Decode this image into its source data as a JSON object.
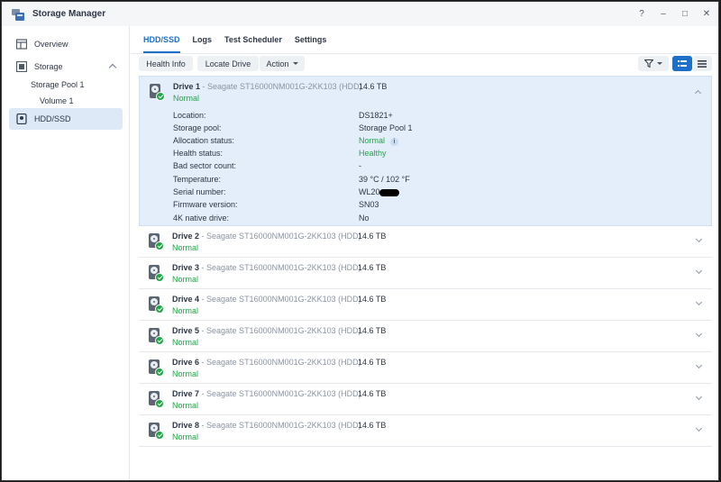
{
  "window": {
    "title": "Storage Manager",
    "controls": [
      "?",
      "–",
      "□",
      "✕"
    ]
  },
  "sidebar": {
    "overview": "Overview",
    "storage": "Storage",
    "storage_pool": "Storage Pool 1",
    "volume": "Volume 1",
    "hdd_ssd": "HDD/SSD"
  },
  "tabs": [
    "HDD/SSD",
    "Logs",
    "Test Scheduler",
    "Settings"
  ],
  "toolbar": {
    "health_info": "Health Info",
    "locate_drive": "Locate Drive",
    "action": "Action"
  },
  "drives": [
    {
      "name": "Drive 1",
      "model": " - Seagate ST16000NM001G-2KK103 (HDD)",
      "size": "14.6 TB",
      "status": "Normal"
    },
    {
      "name": "Drive 2",
      "model": " - Seagate ST16000NM001G-2KK103 (HDD)",
      "size": "14.6 TB",
      "status": "Normal"
    },
    {
      "name": "Drive 3",
      "model": " - Seagate ST16000NM001G-2KK103 (HDD)",
      "size": "14.6 TB",
      "status": "Normal"
    },
    {
      "name": "Drive 4",
      "model": " - Seagate ST16000NM001G-2KK103 (HDD)",
      "size": "14.6 TB",
      "status": "Normal"
    },
    {
      "name": "Drive 5",
      "model": " - Seagate ST16000NM001G-2KK103 (HDD)",
      "size": "14.6 TB",
      "status": "Normal"
    },
    {
      "name": "Drive 6",
      "model": " - Seagate ST16000NM001G-2KK103 (HDD)",
      "size": "14.6 TB",
      "status": "Normal"
    },
    {
      "name": "Drive 7",
      "model": " - Seagate ST16000NM001G-2KK103 (HDD)",
      "size": "14.6 TB",
      "status": "Normal"
    },
    {
      "name": "Drive 8",
      "model": " - Seagate ST16000NM001G-2KK103 (HDD)",
      "size": "14.6 TB",
      "status": "Normal"
    }
  ],
  "details": {
    "location_label": "Location:",
    "location": "DS1821+",
    "pool_label": "Storage pool:",
    "pool": "Storage Pool 1",
    "allocation_label": "Allocation status:",
    "allocation": "Normal",
    "health_label": "Health status:",
    "health": "Healthy",
    "bad_sector_label": "Bad sector count:",
    "bad_sector": "-",
    "temp_label": "Temperature:",
    "temp": "39 °C / 102 °F",
    "serial_label": "Serial number:",
    "serial": "WL20",
    "firmware_label": "Firmware version:",
    "firmware": "SN03",
    "native4k_label": "4K native drive:",
    "native4k": "No"
  },
  "colors": {
    "accent": "#1e6fc8",
    "normal": "#22a447",
    "selected_bg": "#e3eefa"
  }
}
